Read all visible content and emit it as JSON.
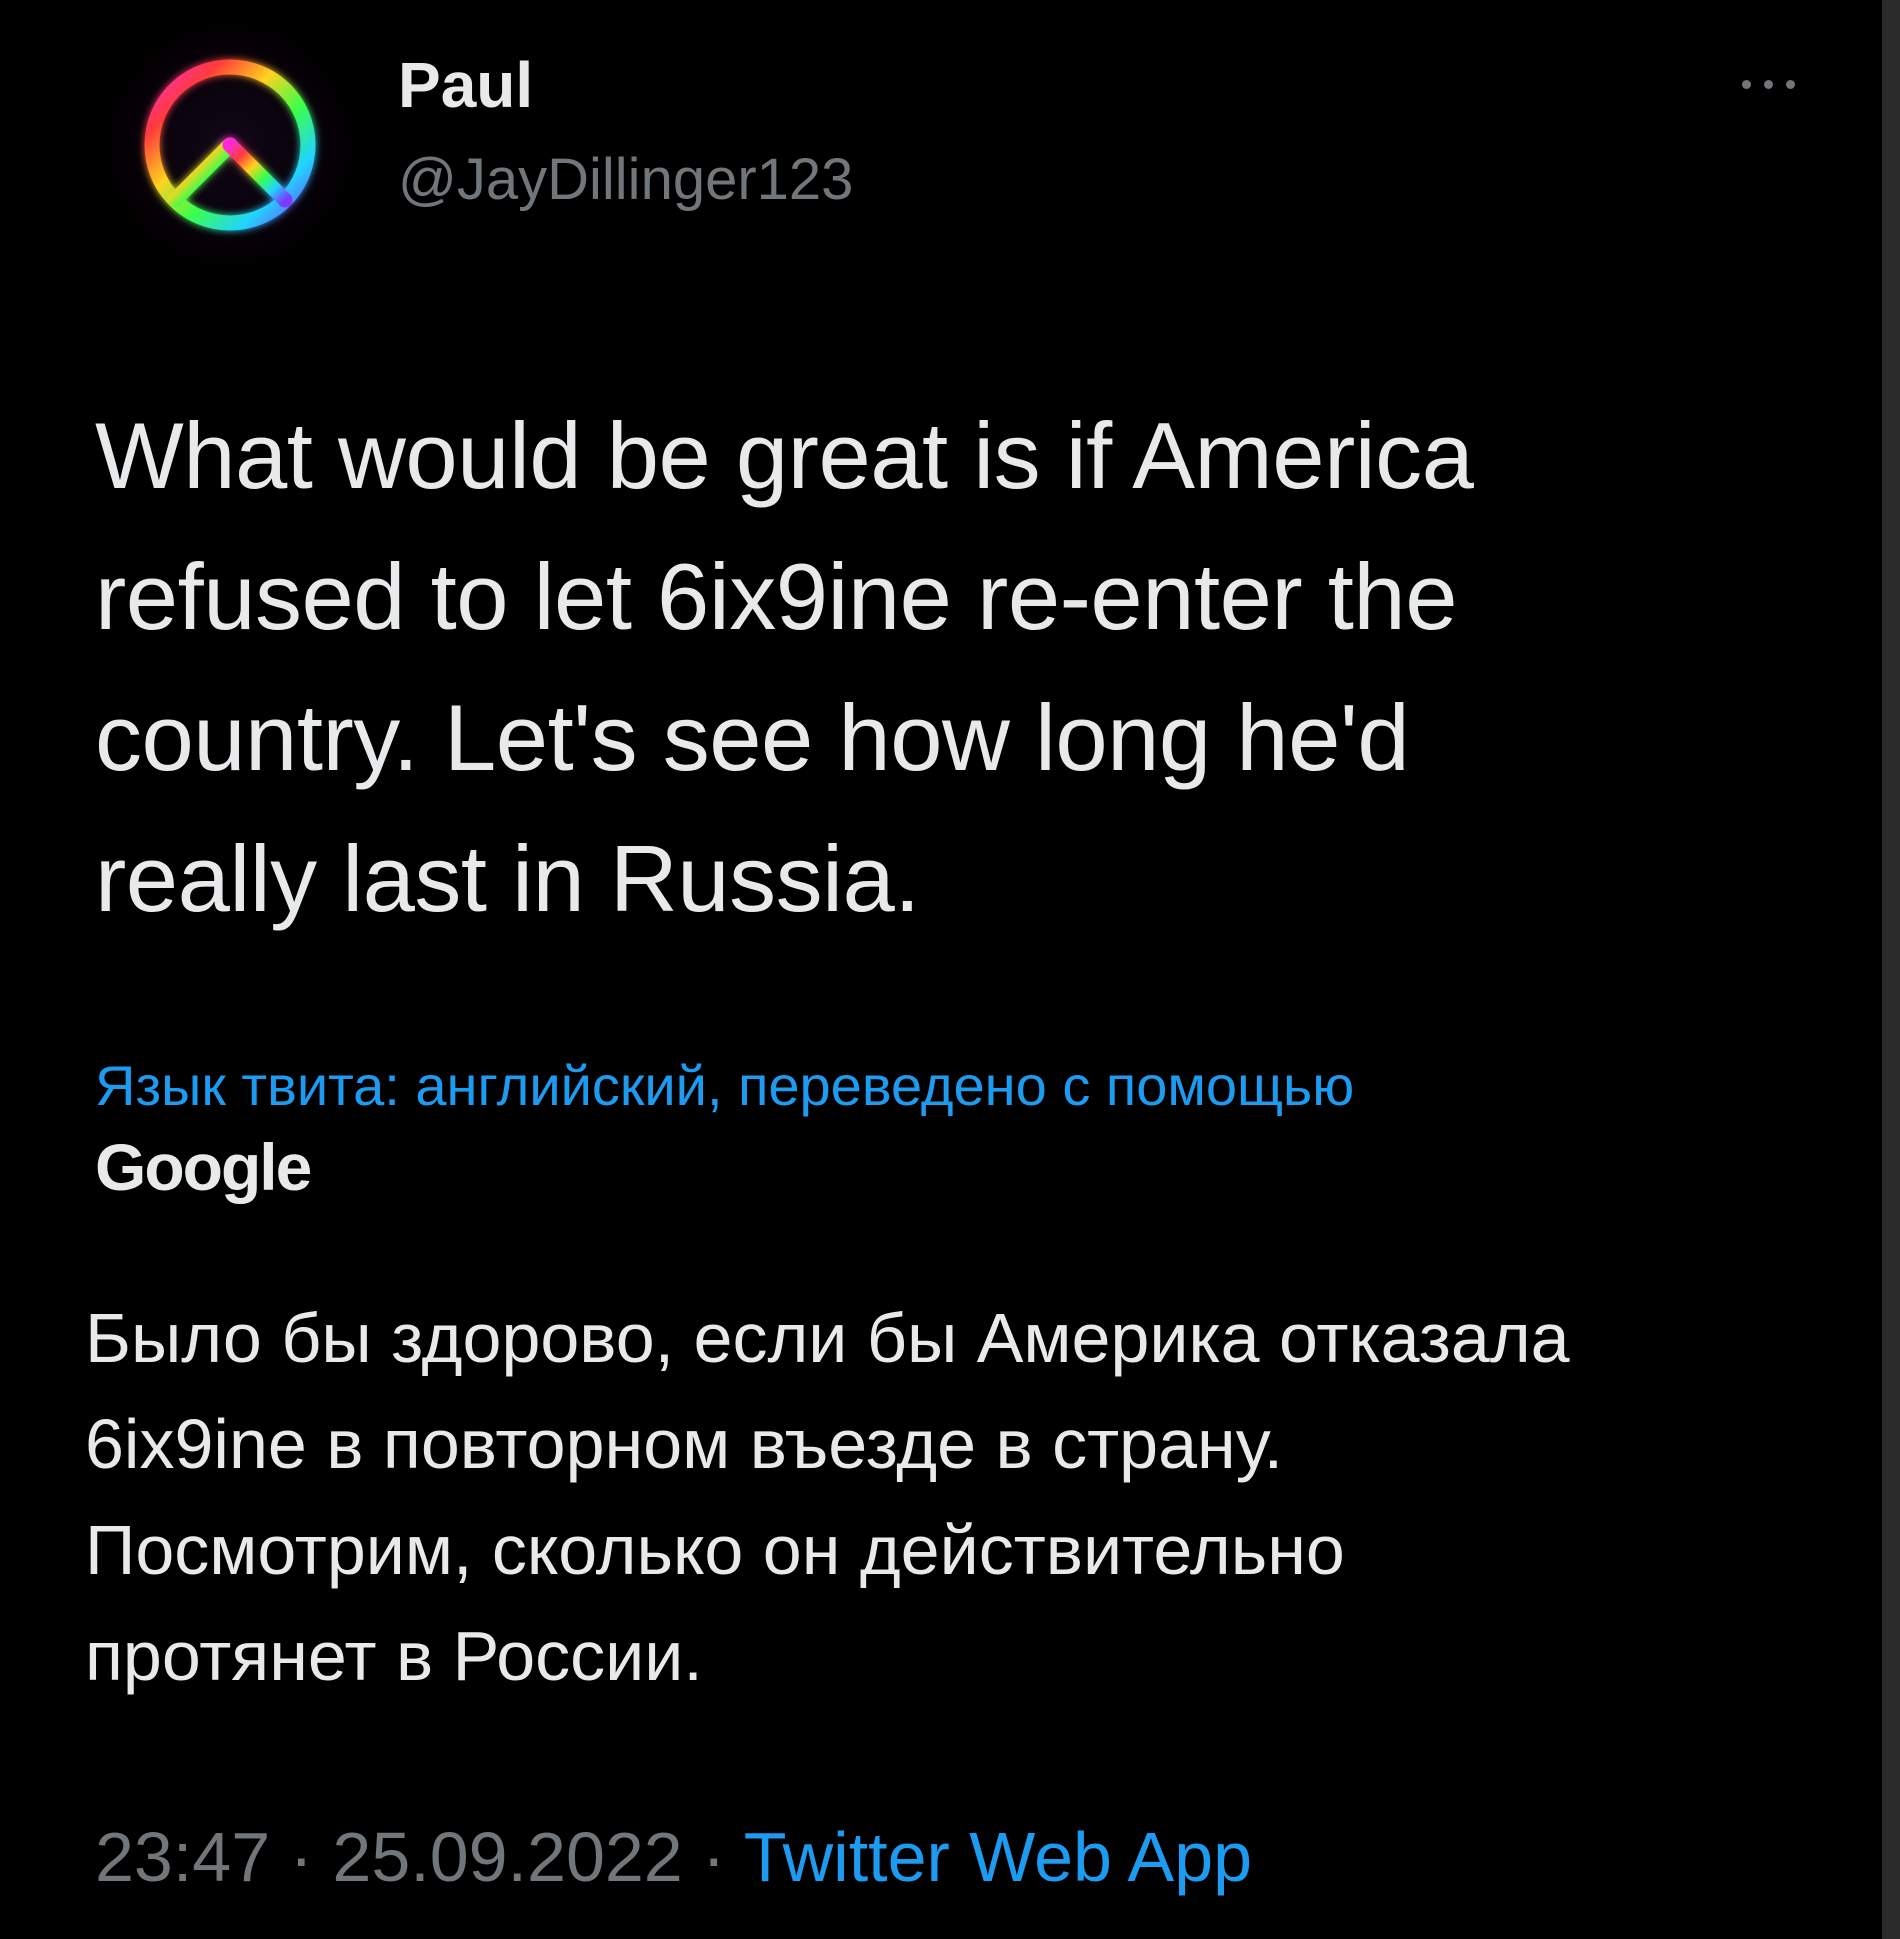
{
  "author": {
    "name": "Paul",
    "handle": "@JayDillinger123",
    "avatar_icon": "peace-sign-icon"
  },
  "menu_icon": "more-options-icon",
  "tweet": {
    "text": "What would be great is if America\nrefused to let 6ix9ine re-enter the\ncountry. Let's see how long he'd\nreally last in Russia."
  },
  "translation": {
    "note": "Язык твита: английский, переведено с помощью",
    "provider": "Google",
    "text": "Было бы здорово, если бы Америка отказала\n6ix9ine в повторном въезде в страну.\nПосмотрим, сколько он действительно\nпротянет в России."
  },
  "meta": {
    "time": "23:47",
    "separator": " · ",
    "date": "25.09.2022",
    "source": "Twitter Web App"
  },
  "colors": {
    "background": "#000000",
    "primary_text": "#e7e9ea",
    "secondary_text": "#71767b",
    "link": "#1d9bf0"
  }
}
